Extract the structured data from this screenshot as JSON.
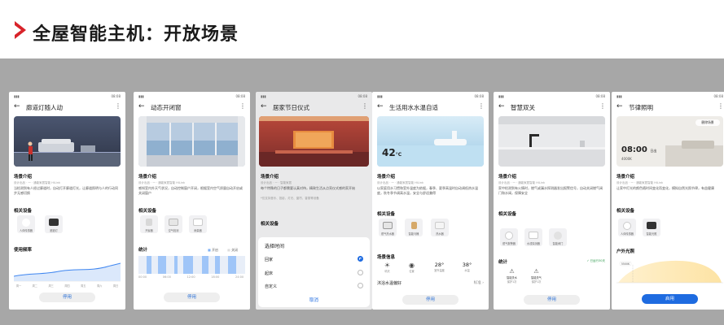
{
  "page": {
    "title": "全屋智能主机：开放场景"
  },
  "status_time": "08:08",
  "common": {
    "section_intro": "场景介绍",
    "section_devices": "相关设备",
    "btn_use": "停用",
    "btn_enable": "启用"
  },
  "phones": [
    {
      "title": "廊道灯随人动",
      "meta": "设计出品  ·  一  ·  通能家居智能 HiLink",
      "desc": "当检测到有人经过廊道时，自动打开廊道灯光，让廊道照明与人的行动同步无感切换",
      "devices": [
        "人体传感器",
        "廊道灯"
      ],
      "extra_title": "使用频率",
      "chart_labels": [
        "周一",
        "周二",
        "周三",
        "周四",
        "周五",
        "周六",
        "周日"
      ],
      "chart_values": [
        2,
        4,
        5,
        7,
        8,
        10,
        12
      ]
    },
    {
      "title": "动态开闭窗",
      "meta": "设计出品  ·  一  ·  通能家居智能 HiLink",
      "desc": "感知室内外天气状况，自动控制窗户开闭，根据室内空气质量自动开启或关闭窗户",
      "devices": [
        "开窗器",
        "空气检测",
        "雨量器"
      ],
      "extra_title": "统计",
      "legend_open": "开启",
      "legend_close": "关闭",
      "time_labels": [
        "00:00",
        "06:00",
        "12:00",
        "18:00",
        "24:00"
      ]
    },
    {
      "title": "居家节日仪式",
      "meta": "设计出品  ·  一  ·  智能家居",
      "desc": "每个特殊的日子都需要认真对待，精致生活从点亮仪式感的家开始",
      "desc2": "*仅支持音乐、投影、灯光、窗帘、香薰等设备",
      "devices_title": "相关设备",
      "sheet_title": "选择时间",
      "options": [
        "回家",
        "起床",
        "自定义"
      ],
      "cancel": "取消"
    },
    {
      "title": "生活用水水温自适",
      "hero_temp": "42",
      "hero_unit": "°C",
      "meta": "设计出品  ·  一  ·  通能家居智能 HiLink",
      "desc": "以家庭用水习惯和室外温度为依据，春季、夏季高温时自动调低热水温度，秋冬季节调高水温，安全与舒适兼得",
      "devices": [
        "燃气热水器",
        "智能马桶",
        "热水器"
      ],
      "weather_title": "场景信息",
      "weather": [
        {
          "icon": "☀",
          "value": "",
          "label": "晴天"
        },
        {
          "icon": "◉",
          "value": "",
          "label": "位置"
        },
        {
          "icon": "",
          "value": "28°",
          "label": "室外温度"
        },
        {
          "icon": "",
          "value": "38°",
          "label": "水温"
        }
      ],
      "pref_label": "沐浴水温偏好",
      "pref_value": "标准"
    },
    {
      "title": "智慧双关",
      "meta": "设计出品  ·  一  ·  通能家居智能 HiLink",
      "desc": "家中检测到有火情时，燃气或漏水探测器发出报警信号，自动关闭燃气阀门和水阀，保障安全",
      "devices": [
        "燃气报警器",
        "水浸探测器",
        "智能阀门"
      ],
      "stats_title": "统计",
      "stats_badge": "已运行30天",
      "stats": [
        {
          "icon": "⚠",
          "label": "智能关水",
          "sub": "保护1次"
        },
        {
          "icon": "⚠",
          "label": "智能关气",
          "sub": "保护1次"
        }
      ]
    },
    {
      "title": "节律照明",
      "hero_btn": "删除场景",
      "hero_time": "08:00",
      "hero_time_suffix": "日出",
      "hero_temp_label": "4000K",
      "meta": "设计出品  ·  一  ·  通能家居智能 HiLink",
      "desc": "让家中灯光的颜色随时间变化而变化，模拟自然光照节律，有益健康",
      "devices": [
        "人体传感器",
        "智能光照"
      ],
      "extra_title": "户外光照",
      "curve_label": "5500K"
    }
  ]
}
